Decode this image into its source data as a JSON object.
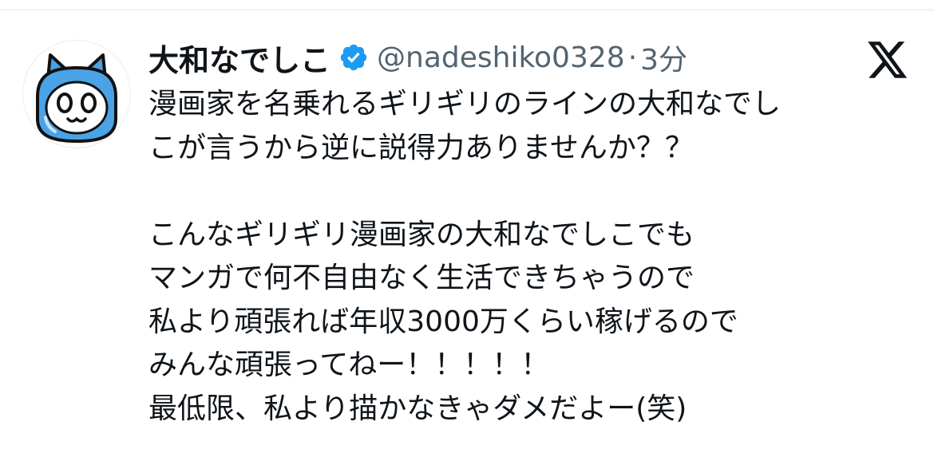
{
  "tweet": {
    "author": {
      "display_name": "大和なでしこ",
      "handle": "@nadeshiko0328",
      "verified": true,
      "avatar_icon": "cat-character-icon"
    },
    "separator": "·",
    "time": "3分",
    "platform_icon": "x-logo-icon",
    "lines": [
      "漫画家を名乗れるギリギリのラインの大和なでし",
      "こが言うから逆に説得力ありませんか？？",
      "",
      "こんなギリギリ漫画家の大和なでしこでも",
      "マンガで何不自由なく生活できちゃうので",
      "私より頑張れば年収3000万くらい稼げるので",
      "みんな頑張ってねー！！！！！",
      "最低限、私より描かなきゃダメだよー(笑)"
    ]
  },
  "colors": {
    "verified_badge": "#1d9bf0",
    "avatar_blue": "#4aa3e6",
    "secondary_text": "#536471",
    "primary_text": "#0f1419"
  }
}
